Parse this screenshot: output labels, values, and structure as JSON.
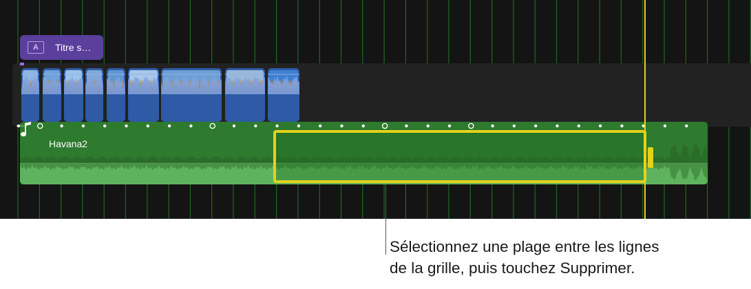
{
  "timeline": {
    "title_clip": {
      "icon": "title-icon",
      "icon_glyph": "A",
      "label": "Titre s…"
    },
    "audio_clip": {
      "icon": "music-note-icon",
      "label": "Havana2",
      "color": "#2e7a2e"
    },
    "selection_color": "#e4d21a",
    "playhead_color": "#e8d21a",
    "gridline_color": "#1f6a1f"
  },
  "callout": {
    "line1": "Sélectionnez une plage entre les lignes",
    "line2": "de la grille, puis touchez Supprimer."
  }
}
